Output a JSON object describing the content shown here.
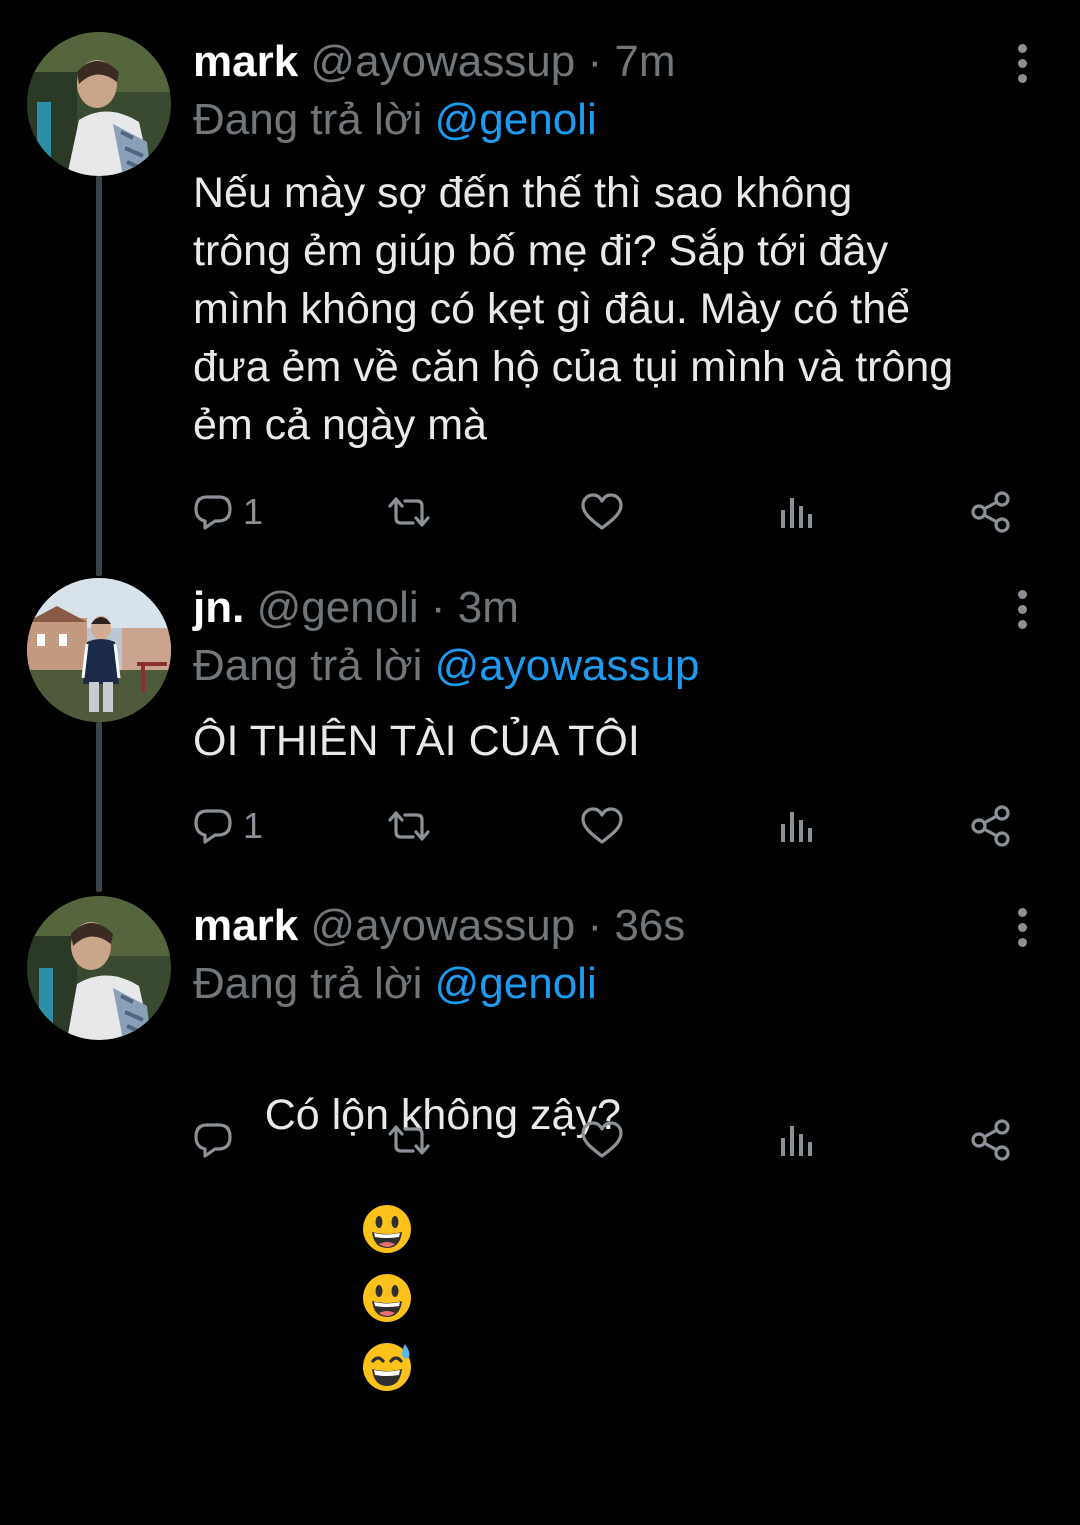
{
  "tweets": [
    {
      "name": "mark",
      "handle": "@ayowassup",
      "separator": "·",
      "time": "7m",
      "reply_prefix": "Đang trả lời",
      "reply_to": "@genoli",
      "text": "Nếu mày sợ đến thế thì sao không\ntrông ẻm giúp bố mẹ đi? Sắp tới đây\nmình không có kẹt gì đâu. Mày có thể\nđưa ẻm về căn hộ của tụi mình và trông\nẻm cả ngày mà",
      "reply_count": "1"
    },
    {
      "name": "jn.",
      "handle": "@genoli",
      "separator": "·",
      "time": "3m",
      "reply_prefix": "Đang trả lời",
      "reply_to": "@ayowassup",
      "text": "ÔI THIÊN TÀI CỦA TÔI",
      "reply_count": "1"
    },
    {
      "name": "mark",
      "handle": "@ayowassup",
      "separator": "·",
      "time": "36s",
      "reply_prefix": "Đang trả lời",
      "reply_to": "@genoli",
      "text": "Có lộn không zậy?",
      "reply_count": "",
      "emojis": [
        "grinning-face-emoji",
        "grinning-face-emoji",
        "grinning-face-with-sweat-emoji"
      ]
    }
  ],
  "icons": {
    "reply": "reply-icon",
    "retweet": "retweet-icon",
    "like": "heart-icon",
    "views": "analytics-icon",
    "share": "share-icon",
    "more": "more-vertical-icon"
  },
  "colors": {
    "background": "#000000",
    "text": "#e7e9ea",
    "secondary": "#71767b",
    "link": "#1d9bf0",
    "thread_line": "#3d4448"
  }
}
